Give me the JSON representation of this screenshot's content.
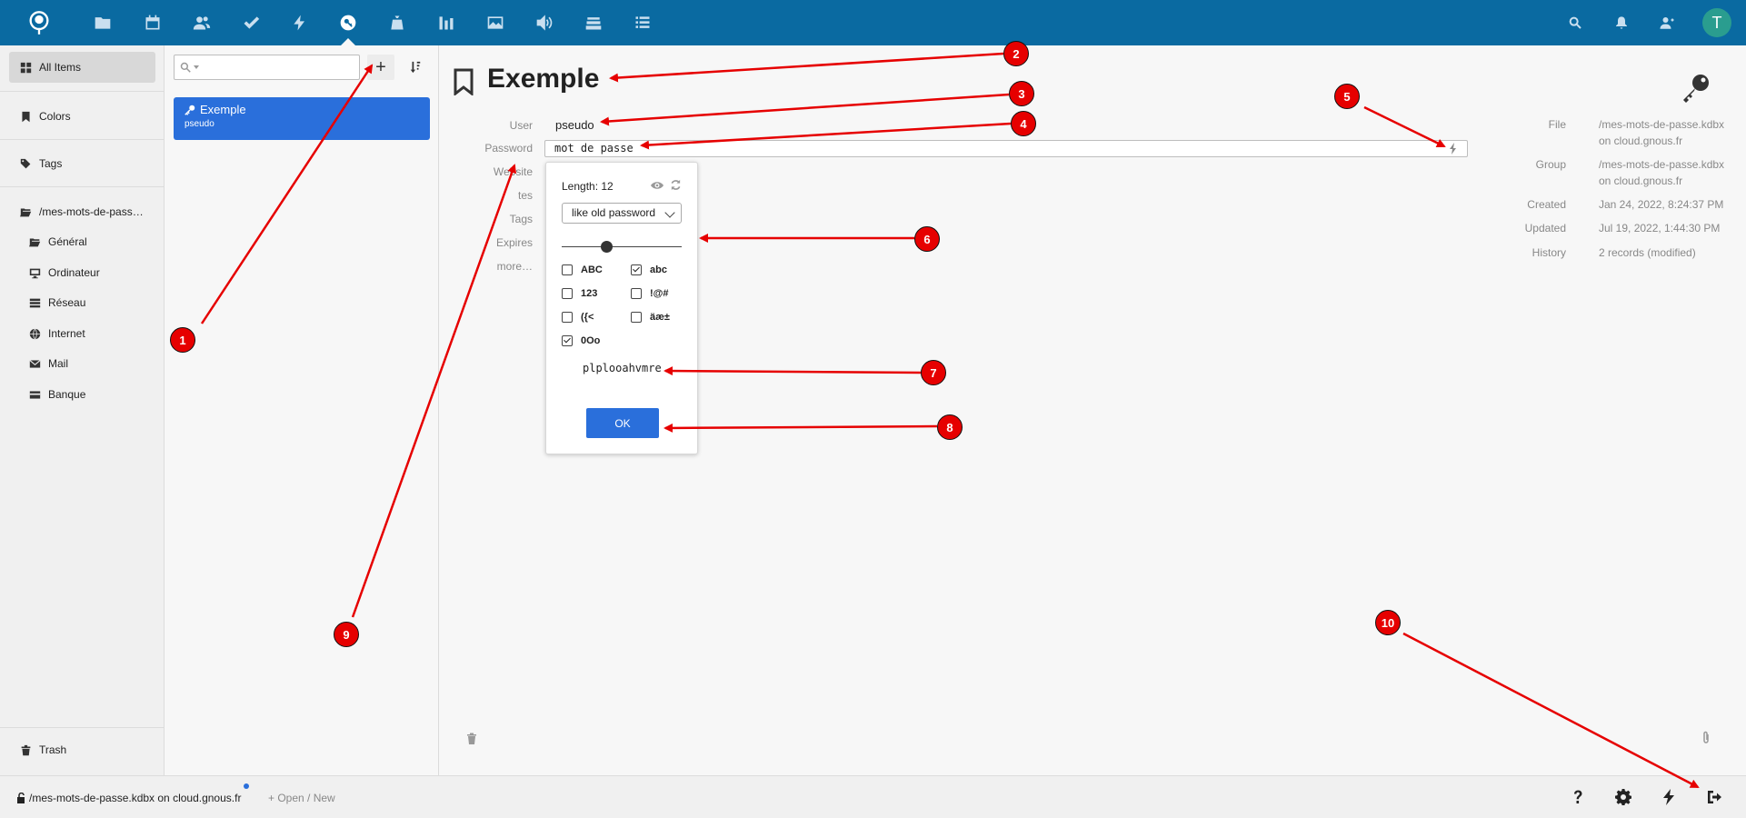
{
  "topbar": {
    "nav_icons": [
      "logo-icon",
      "folder-icon",
      "calendar-icon",
      "contacts-icon",
      "tasks-icon",
      "activity-icon",
      "passwords-icon",
      "money-icon",
      "charts-icon",
      "photos-icon",
      "audio-icon",
      "deck-icon",
      "list-icon"
    ],
    "active_icon": "passwords-icon",
    "right_icons": [
      "search-icon",
      "bell-icon",
      "contacts-menu-icon"
    ],
    "avatar_letter": "T",
    "color": "#0a6aa1"
  },
  "sidebar": {
    "all_items": "All Items",
    "colors": "Colors",
    "tags": "Tags",
    "root_group": "/mes-mots-de-pass…",
    "groups": [
      {
        "label": "Général",
        "icon": "folder-open-icon"
      },
      {
        "label": "Ordinateur",
        "icon": "desktop-icon"
      },
      {
        "label": "Réseau",
        "icon": "server-icon"
      },
      {
        "label": "Internet",
        "icon": "globe-icon"
      },
      {
        "label": "Mail",
        "icon": "envelope-icon"
      },
      {
        "label": "Banque",
        "icon": "credit-card-icon"
      }
    ],
    "trash": "Trash"
  },
  "list": {
    "search_placeholder": "",
    "add_label": "+",
    "entries": [
      {
        "title": "Exemple",
        "subtitle": "pseudo"
      }
    ]
  },
  "detail": {
    "title": "Exemple",
    "fields": {
      "user_label": "User",
      "user_value": "pseudo",
      "password_label": "Password",
      "password_value": "mot de passe",
      "website_label": "Website",
      "notes_label": "Notes",
      "notes_visible": "tes",
      "tags_label": "Tags",
      "expires_label": "Expires",
      "more_label": "more…"
    },
    "meta": {
      "file_label": "File",
      "file_value_1": "/mes-mots-de-passe.kdbx",
      "file_value_2": "on cloud.gnous.fr",
      "group_label": "Group",
      "group_value_1": "/mes-mots-de-passe.kdbx",
      "group_value_2": "on cloud.gnous.fr",
      "created_label": "Created",
      "created_value": "Jan 24, 2022, 8:24:37 PM",
      "updated_label": "Updated",
      "updated_value": "Jul 19, 2022, 1:44:30 PM",
      "history_label": "History",
      "history_value": "2 records (modified)"
    }
  },
  "generator": {
    "length_label": "Length: 12",
    "length": 12,
    "preset": "like old password",
    "slider_fraction": 0.37,
    "options": [
      {
        "label": "ABC",
        "checked": false
      },
      {
        "label": "abc",
        "checked": true
      },
      {
        "label": "123",
        "checked": false
      },
      {
        "label": "!@#",
        "checked": false
      },
      {
        "label": "({<",
        "checked": false
      },
      {
        "label": "äæ±",
        "checked": false
      },
      {
        "label": "0Oo",
        "checked": true
      }
    ],
    "sample": "plplooahvmre",
    "ok_label": "OK"
  },
  "footer": {
    "db_label": "/mes-mots-de-passe.kdbx on cloud.gnous.fr",
    "open_label": "+ Open / New",
    "icons": [
      "help-icon",
      "settings-icon",
      "generator-icon",
      "logout-icon"
    ]
  },
  "annotations": {
    "badges": [
      "1",
      "2",
      "3",
      "4",
      "5",
      "6",
      "7",
      "8",
      "9",
      "10"
    ],
    "color": "#e60000"
  }
}
